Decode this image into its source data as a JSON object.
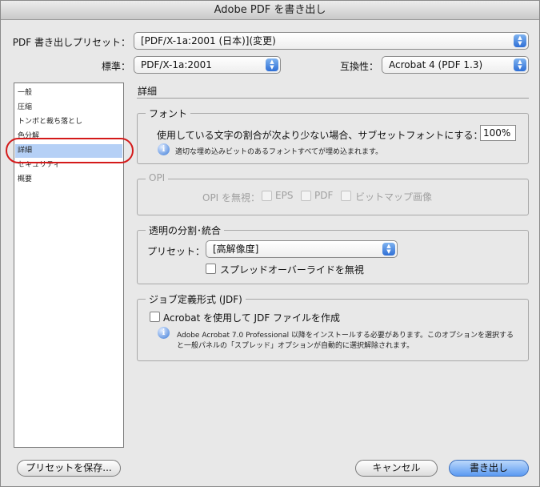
{
  "window": {
    "title": "Adobe PDF を書き出し"
  },
  "preset": {
    "label": "PDF 書き出しプリセット：",
    "value": "[PDF/X-1a:2001 (日本)](変更)"
  },
  "standard": {
    "label": "標準：",
    "value": "PDF/X-1a:2001"
  },
  "compat": {
    "label": "互換性：",
    "value": "Acrobat 4 (PDF 1.3)"
  },
  "sidebar": {
    "items": [
      {
        "label": "一般"
      },
      {
        "label": "圧縮"
      },
      {
        "label": "トンボと裁ち落とし"
      },
      {
        "label": "色分解"
      },
      {
        "label": "詳細",
        "selected": true
      },
      {
        "label": "セキュリティ"
      },
      {
        "label": "概要"
      }
    ]
  },
  "main": {
    "title": "詳細",
    "font": {
      "title": "フォント",
      "subset_label": "使用している文字の割合が次より少ない場合、サブセットフォントにする：",
      "subset_value": "100%",
      "info": "適切な埋め込みビットのあるフォントすべてが埋め込まれます。"
    },
    "opi": {
      "title": "OPI",
      "ignore_label": "OPI を無視：",
      "eps": "EPS",
      "pdf": "PDF",
      "bitmap": "ビットマップ画像"
    },
    "flatten": {
      "title": "透明の分割･統合",
      "preset_label": "プリセット：",
      "preset_value": "[高解像度]",
      "ignore_spread": "スプレッドオーバーライドを無視"
    },
    "jdf": {
      "title": "ジョブ定義形式 (JDF)",
      "create_label": "Acrobat を使用して JDF ファイルを作成",
      "info_line1": "Adobe Acrobat 7.0 Professional 以降をインストールする必要があります。このオプションを選択する",
      "info_line2": "と一般パネルの「スプレッド」オプションが自動的に選択解除されます。"
    }
  },
  "buttons": {
    "save_preset": "プリセットを保存...",
    "cancel": "キャンセル",
    "export": "書き出し"
  },
  "icons": {
    "popup": "updown-arrows-icon",
    "info": "info-icon"
  },
  "colors": {
    "selection": "#b5d0f6",
    "annotation_ring": "#d41a1a",
    "default_button": "#5b9af2"
  }
}
